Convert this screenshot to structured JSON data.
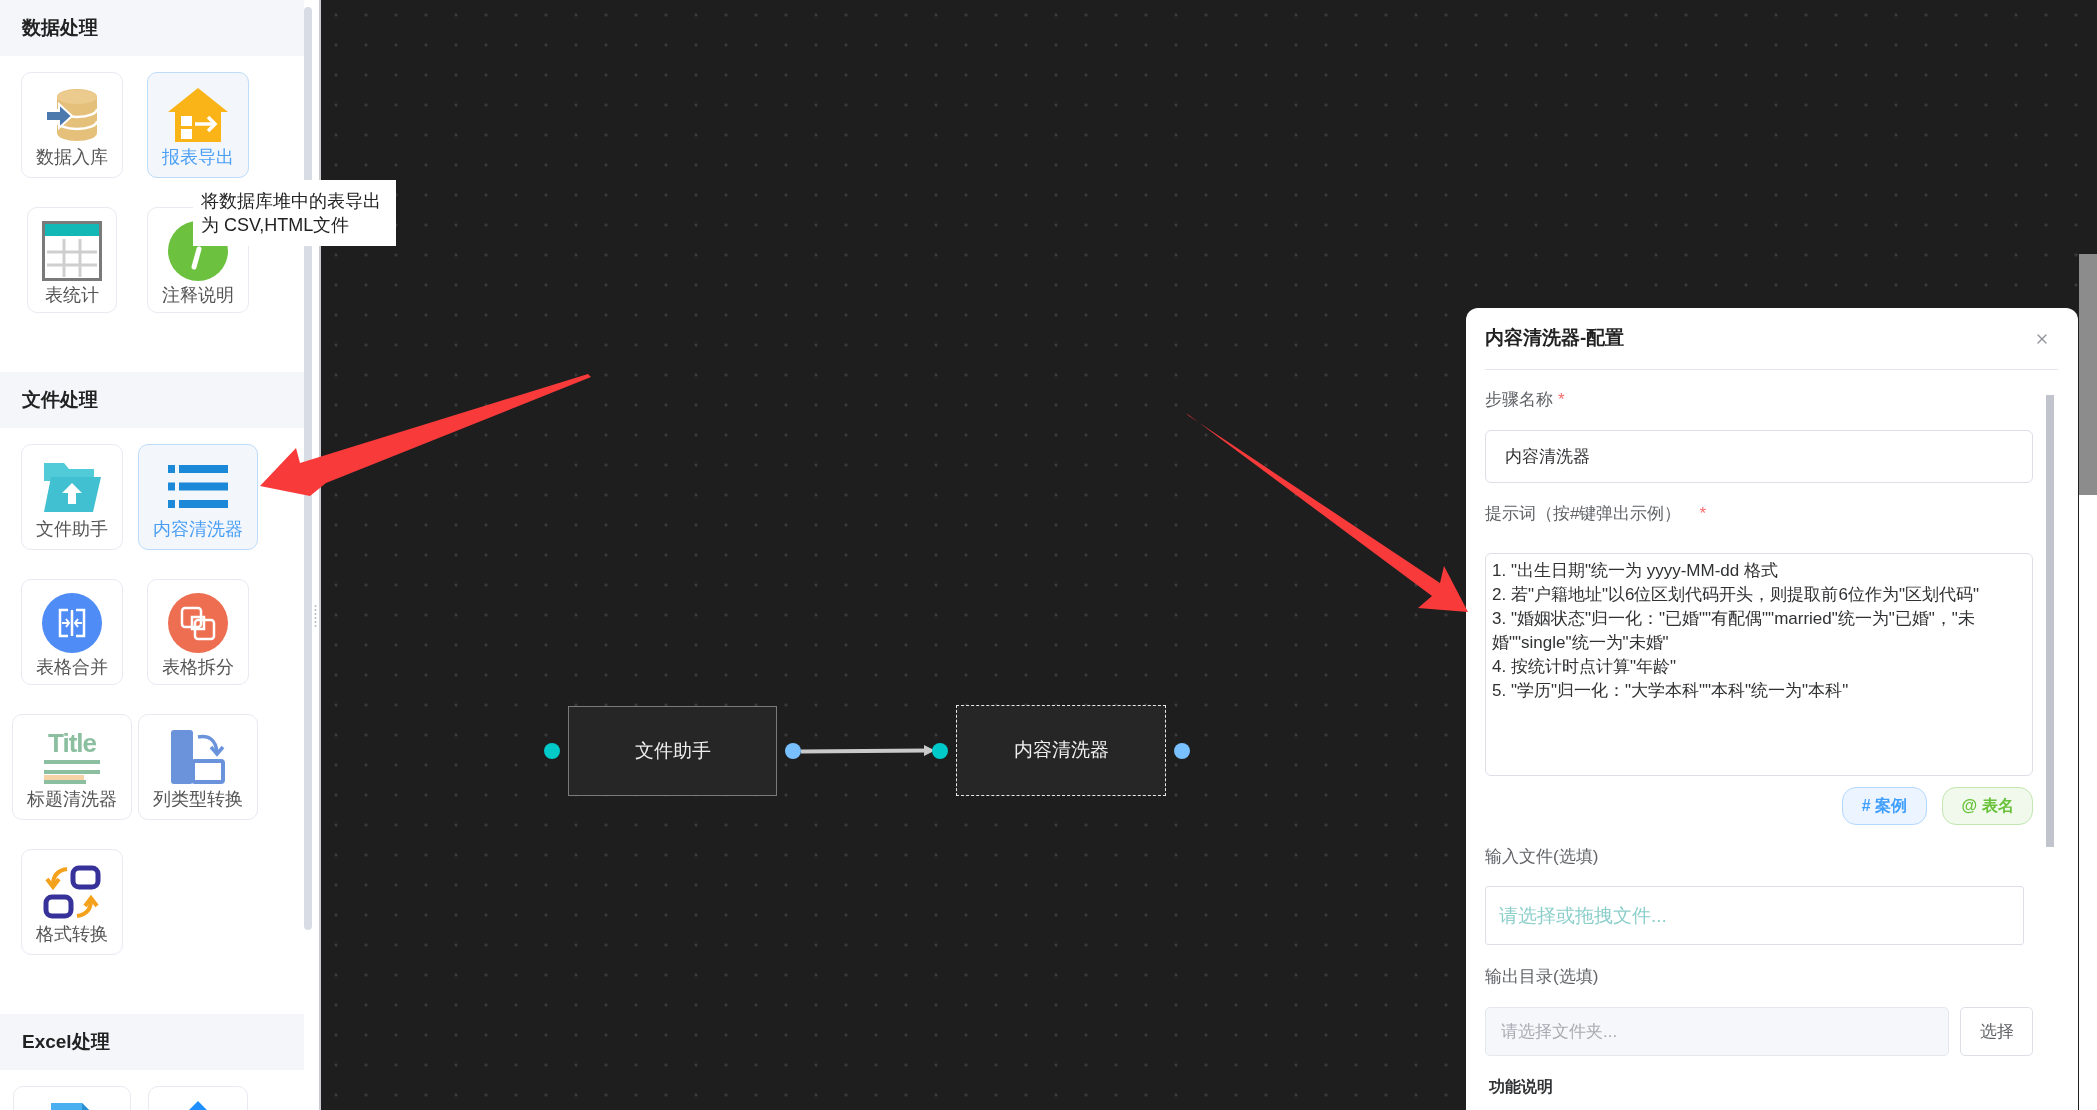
{
  "sidebar": {
    "sections": [
      {
        "title": "数据处理",
        "items": [
          {
            "kind": "database",
            "label": "数据入库",
            "selected": false
          },
          {
            "kind": "export",
            "label": "报表导出",
            "selected": true
          },
          {
            "kind": "table",
            "label": "表统计",
            "selected": false
          },
          {
            "kind": "info",
            "label": "注释说明",
            "selected": false
          }
        ]
      },
      {
        "title": "文件处理",
        "items": [
          {
            "kind": "folder",
            "label": "文件助手",
            "selected": false
          },
          {
            "kind": "list",
            "label": "内容清洗器",
            "selected": true
          },
          {
            "kind": "merge",
            "label": "表格合并",
            "selected": false
          },
          {
            "kind": "split",
            "label": "表格拆分",
            "selected": false
          },
          {
            "kind": "title",
            "icon_text": "Title",
            "label": "标题清洗器",
            "selected": false
          },
          {
            "kind": "column",
            "label": "列类型转换",
            "selected": false
          },
          {
            "kind": "convert",
            "label": "格式转换",
            "selected": false
          }
        ]
      },
      {
        "title": "Excel处理",
        "items": [
          {
            "kind": "sheet",
            "selected": false
          },
          {
            "kind": "roof",
            "selected": false
          }
        ]
      }
    ]
  },
  "tooltip": {
    "text": "将数据库堆中的表导出为 CSV,HTML文件"
  },
  "canvas": {
    "nodes": [
      {
        "label": "文件助手",
        "selected": false
      },
      {
        "label": "内容清洗器",
        "selected": true
      }
    ]
  },
  "panel": {
    "title": "内容清洗器-配置",
    "fields": [
      {
        "kind": "text",
        "label": "步骤名称",
        "required_mark": "*",
        "value": "内容清洗器"
      },
      {
        "kind": "textarea",
        "label": "提示词（按#键弹出示例）",
        "required_mark": "*",
        "value": "1. \"出生日期\"统一为 yyyy-MM-dd 格式\n2. 若\"户籍地址\"以6位区划代码开头，则提取前6位作为\"区划代码\"\n3. \"婚姻状态\"归一化：\"已婚\"\"有配偶\"\"married\"统一为\"已婚\"，\"未婚\"\"single\"统一为\"未婚\"\n4. 按统计时点计算\"年龄\"\n5. \"学历\"归一化：\"大学本科\"\"本科\"统一为\"本科\"",
        "chips": [
          {
            "kind": "example",
            "label": "# 案例"
          },
          {
            "kind": "table",
            "label": "@ 表名"
          }
        ]
      },
      {
        "kind": "file",
        "label": "输入文件(选填)",
        "placeholder": "请选择或拖拽文件..."
      },
      {
        "kind": "folder",
        "label": "输出目录(选填)",
        "placeholder": "请选择文件夹...",
        "button": "选择"
      }
    ],
    "section_title": "功能说明"
  }
}
